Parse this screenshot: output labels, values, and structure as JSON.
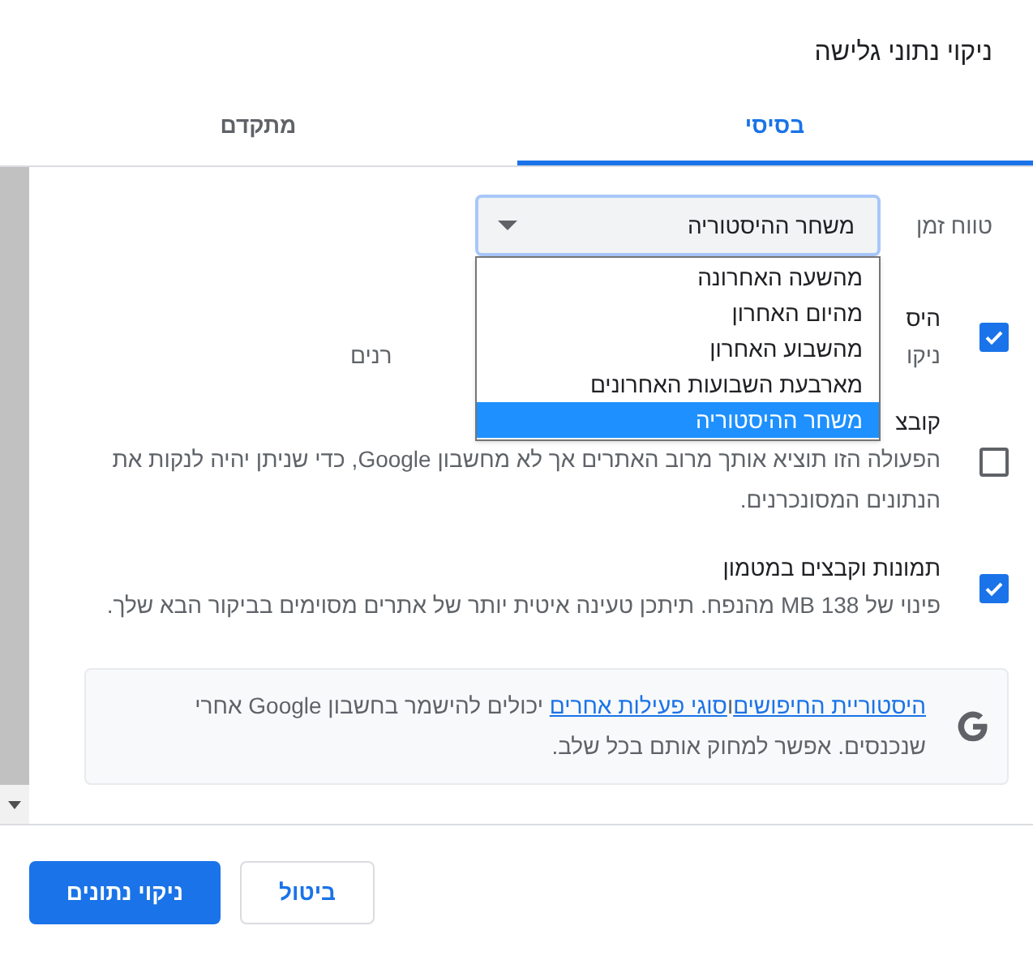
{
  "dialog": {
    "title": "ניקוי נתוני גלישה"
  },
  "tabs": [
    {
      "label": "בסיסי",
      "selected": true
    },
    {
      "label": "מתקדם",
      "selected": false
    }
  ],
  "time_range": {
    "label": "טווח זמן",
    "value": "משחר ההיסטוריה",
    "expanded": true,
    "options": [
      {
        "label": "מהשעה האחרונה",
        "selected": false
      },
      {
        "label": "מהיום האחרון",
        "selected": false
      },
      {
        "label": "מהשבוע האחרון",
        "selected": false
      },
      {
        "label": "מארבעת השבועות האחרונים",
        "selected": false
      },
      {
        "label": "משחר ההיסטוריה",
        "selected": true
      }
    ]
  },
  "items": [
    {
      "title": "היס",
      "description_parts": [
        "ניקו",
        "רנים"
      ],
      "checked": true
    },
    {
      "title": "קובצ",
      "description": "הפעולה הזו תוציא אותך מרוב האתרים אך לא מחשבון Google, כדי שניתן יהיה לנקות את הנתונים המסונכרנים.",
      "checked": false
    },
    {
      "title": "תמונות וקבצים במטמון",
      "description": "פינוי של 138 MB מהנפח. תיתכן טעינה איטית יותר של אתרים מסוימים בביקור הבא שלך.",
      "checked": true
    }
  ],
  "info": {
    "link_1": "היסטוריית החיפושים",
    "joiner": "ו",
    "link_2": "סוגי פעילות אחרים",
    "rest": " יכולים להישמר בחשבון Google אחרי שנכנסים. אפשר למחוק אותם בכל שלב."
  },
  "buttons": {
    "cancel": "ביטול",
    "confirm": "ניקוי נתונים"
  }
}
